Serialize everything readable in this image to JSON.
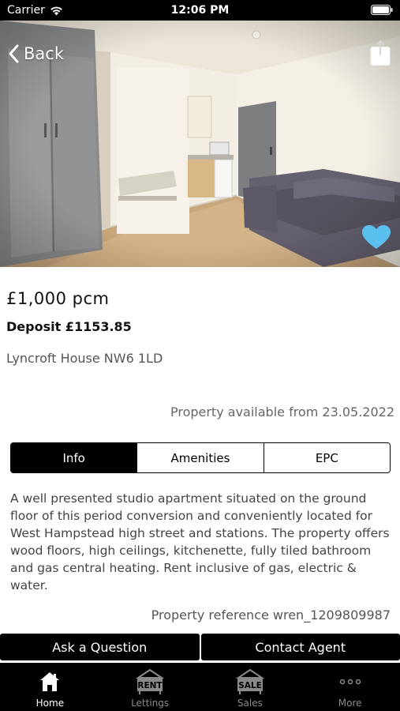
{
  "status_bar": {
    "carrier": "Carrier",
    "time": "12:06 PM"
  },
  "hero": {
    "back_label": "Back",
    "share_icon": "share-icon",
    "favorite_icon": "heart-icon",
    "favorite_color": "#5bc0ef"
  },
  "listing": {
    "price": "£1,000 pcm",
    "deposit": "Deposit £1153.85",
    "address": "Lyncroft House NW6 1LD",
    "availability": "Property available from 23.05.2022",
    "description": "A well presented studio apartment situated on the ground floor of this period conversion and conveniently located for West Hampstead high street and stations. The property offers wood floors, high ceilings, kitchenette, fully tiled bathroom and gas central heating. Rent inclusive of gas, electric & water.",
    "reference": "Property reference wren_1209809987"
  },
  "tabs": [
    {
      "label": "Info",
      "active": true
    },
    {
      "label": "Amenities",
      "active": false
    },
    {
      "label": "EPC",
      "active": false
    }
  ],
  "actions": {
    "ask_label": "Ask a Question",
    "contact_label": "Contact Agent"
  },
  "tab_bar": {
    "items": [
      {
        "label": "Home",
        "icon": "home-icon",
        "active": true
      },
      {
        "label": "Lettings",
        "icon": "rent-sign-icon",
        "icon_text": "RENT",
        "active": false
      },
      {
        "label": "Sales",
        "icon": "sale-sign-icon",
        "icon_text": "SALE",
        "active": false
      },
      {
        "label": "More",
        "icon": "more-icon",
        "active": false
      }
    ]
  },
  "colors": {
    "accent": "#000000",
    "heart": "#5bc0ef"
  }
}
